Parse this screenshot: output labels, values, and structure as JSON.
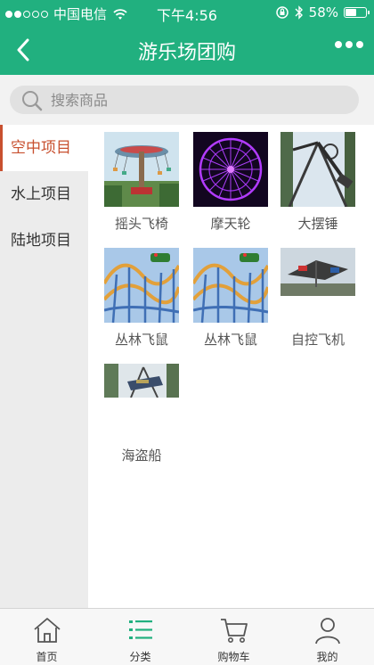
{
  "status_bar": {
    "carrier": "中国电信",
    "time": "下午4:56",
    "battery": "58%",
    "battery_level": 0.58,
    "signal_bars": 2
  },
  "nav": {
    "title": "游乐场团购"
  },
  "search": {
    "placeholder": "搜索商品"
  },
  "sidebar": {
    "items": [
      {
        "label": "空中项目",
        "active": true
      },
      {
        "label": "水上项目",
        "active": false
      },
      {
        "label": "陆地项目",
        "active": false
      }
    ]
  },
  "products": [
    {
      "name": "摇头飞椅",
      "image": "swing-ride-photo"
    },
    {
      "name": "摩天轮",
      "image": "ferris-wheel-photo"
    },
    {
      "name": "大摆锤",
      "image": "pendulum-ride-photo"
    },
    {
      "name": "丛林飞鼠",
      "image": "roller-coaster-photo"
    },
    {
      "name": "丛林飞鼠",
      "image": "roller-coaster-photo"
    },
    {
      "name": "自控飞机",
      "image": "plane-ride-photo"
    },
    {
      "name": "海盗船",
      "image": "pirate-ship-photo"
    }
  ],
  "tabs": [
    {
      "label": "首页",
      "icon": "home-icon"
    },
    {
      "label": "分类",
      "icon": "list-icon",
      "active": true
    },
    {
      "label": "购物车",
      "icon": "cart-icon"
    },
    {
      "label": "我的",
      "icon": "user-icon"
    }
  ],
  "colors": {
    "brand": "#21b07f",
    "active_category": "#c8502f",
    "active_tab_icon": "#21b07f"
  }
}
